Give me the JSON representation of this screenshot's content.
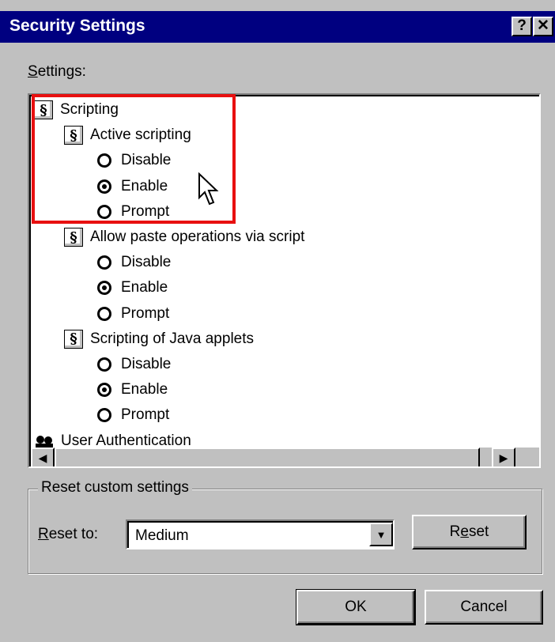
{
  "window": {
    "title": "Security Settings",
    "help_button": "?",
    "close_button": "✕"
  },
  "settings_label_prefix": "S",
  "settings_label_rest": "ettings:",
  "list": {
    "items": [
      {
        "kind": "category",
        "label": "Scripting",
        "icon": "script-icon"
      },
      {
        "kind": "setting",
        "label": "Active scripting",
        "icon": "script-icon"
      },
      {
        "kind": "option",
        "label": "Disable",
        "checked": false
      },
      {
        "kind": "option",
        "label": "Enable",
        "checked": true
      },
      {
        "kind": "option",
        "label": "Prompt",
        "checked": false
      },
      {
        "kind": "setting",
        "label": "Allow paste operations via script",
        "icon": "script-icon"
      },
      {
        "kind": "option",
        "label": "Disable",
        "checked": false
      },
      {
        "kind": "option",
        "label": "Enable",
        "checked": true
      },
      {
        "kind": "option",
        "label": "Prompt",
        "checked": false
      },
      {
        "kind": "setting",
        "label": "Scripting of Java applets",
        "icon": "script-icon"
      },
      {
        "kind": "option",
        "label": "Disable",
        "checked": false
      },
      {
        "kind": "option",
        "label": "Enable",
        "checked": true
      },
      {
        "kind": "option",
        "label": "Prompt",
        "checked": false
      },
      {
        "kind": "category",
        "label": "User Authentication",
        "icon": "user-icon"
      }
    ]
  },
  "reset_group": {
    "title": "Reset custom settings",
    "reset_to_prefix": "R",
    "reset_to_rest": "eset to:",
    "selected_level": "Medium",
    "reset_button_a": "R",
    "reset_button_u": "e",
    "reset_button_b": "set"
  },
  "footer": {
    "ok_label": "OK",
    "cancel_label": "Cancel"
  },
  "colors": {
    "titlebar": "#000080",
    "highlight": "#e81010",
    "face": "#c0c0c0"
  }
}
